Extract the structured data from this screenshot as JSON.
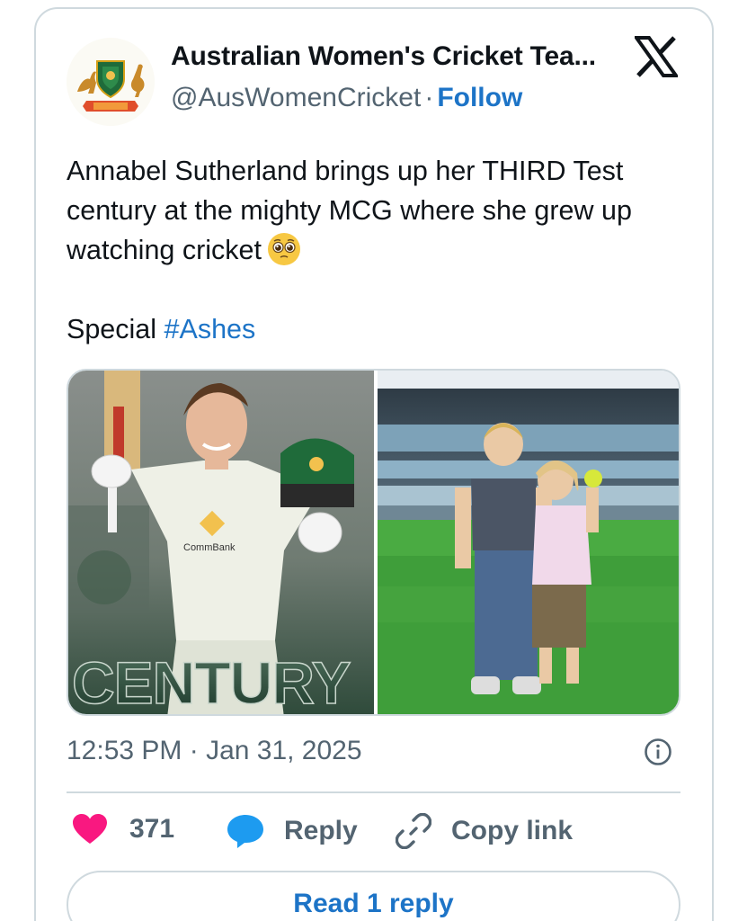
{
  "account": {
    "name": "Australian Women's Cricket Tea...",
    "handle": "@AusWomenCricket",
    "separator": "·",
    "follow_label": "Follow",
    "avatar_icon": "cricket-australia-crest-icon"
  },
  "platform_icon": "x-logo-icon",
  "tweet": {
    "text_lines": [
      "Annabel Sutherland brings up her THIRD Test",
      "century at the mighty MCG where she grew up",
      "watching cricket"
    ],
    "emoji": "pleading-face-emoji",
    "special_text": "Special",
    "hashtag": "#Ashes"
  },
  "media": {
    "photo1": {
      "description_icon": "century-celebration-photo",
      "overlay_text": "CENTURY",
      "shirt_text": "CommBank"
    },
    "photo2": {
      "description_icon": "children-at-mcg-photo"
    }
  },
  "meta": {
    "timestamp": "12:53 PM · Jan 31, 2025",
    "info_icon": "info-icon"
  },
  "actions": {
    "like_count": "371",
    "reply_label": "Reply",
    "copy_label": "Copy link"
  },
  "read_reply_label": "Read 1 reply",
  "colors": {
    "accent": "#1d74c7",
    "like": "#f91880",
    "reply_icon": "#1d9bf0",
    "secondary_text": "#536471",
    "border": "#cfd9de"
  }
}
